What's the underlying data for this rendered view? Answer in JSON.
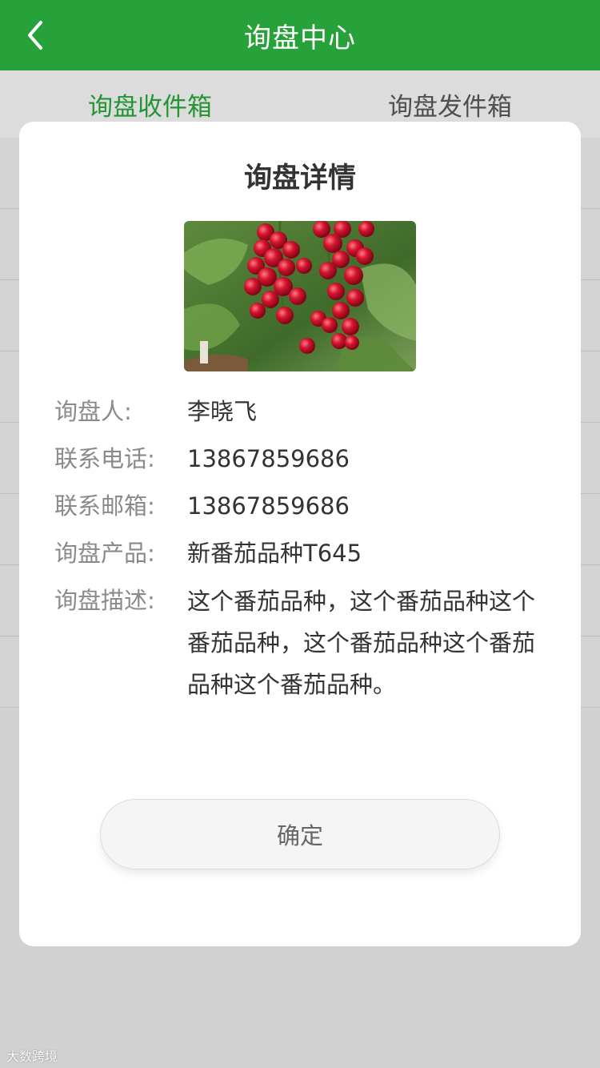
{
  "header": {
    "title": "询盘中心"
  },
  "tabs": [
    {
      "label": "询盘收件箱",
      "active": true
    },
    {
      "label": "询盘发件箱",
      "active": false
    }
  ],
  "modal": {
    "title": "询盘详情",
    "image": {
      "subject": "red currant berries"
    },
    "fields": [
      {
        "label": "询盘人:",
        "value": "李晓飞"
      },
      {
        "label": "联系电话:",
        "value": "13867859686"
      },
      {
        "label": "联系邮箱:",
        "value": "13867859686"
      },
      {
        "label": "询盘产品:",
        "value": "新番茄品种T645"
      },
      {
        "label": "询盘描述:",
        "value": "这个番茄品种，这个番茄品种这个番茄品种，这个番茄品种这个番茄品种这个番茄品种。"
      }
    ],
    "confirm_label": "确定"
  },
  "watermark": "大数跨境",
  "colors": {
    "brand_green": "#27a23a",
    "berry_red": "#c8102e"
  }
}
